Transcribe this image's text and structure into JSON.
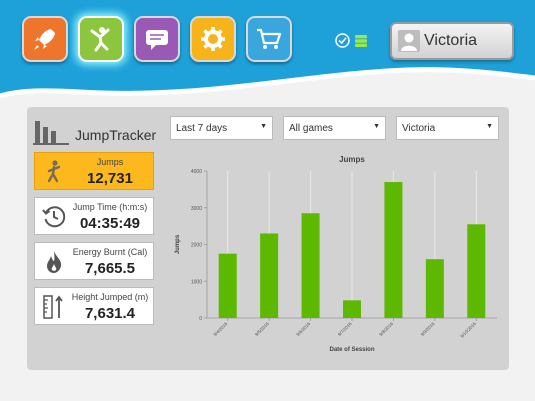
{
  "nav": {
    "apps": [
      {
        "name": "rocket-app-button",
        "color": "#f0752c",
        "icon": "rocket-icon"
      },
      {
        "name": "activity-app-button",
        "color": "#8cc63f",
        "icon": "jumping-person-icon",
        "active": true
      },
      {
        "name": "messages-app-button",
        "color": "#9b59b6",
        "icon": "chat-icon"
      },
      {
        "name": "settings-app-button",
        "color": "#f7b41a",
        "icon": "gear-icon"
      },
      {
        "name": "store-app-button",
        "color": "#3aa6dd",
        "icon": "cart-icon"
      }
    ],
    "topbar_color": "#1ea1d9"
  },
  "user": {
    "name": "Victoria"
  },
  "logo": {
    "title": "JumpTracker"
  },
  "filters": {
    "period": "Last 7 days",
    "game": "All games",
    "player": "Victoria"
  },
  "stats": [
    {
      "label": "Jumps",
      "value": "12,731",
      "icon": "jumper-icon",
      "highlight": true
    },
    {
      "label": "Jump Time (h:m:s)",
      "value": "04:35:49",
      "icon": "clock-icon"
    },
    {
      "label": "Energy Burnt (Cal)",
      "value": "7,665.5",
      "icon": "flame-icon"
    },
    {
      "label": "Height Jumped (m)",
      "value": "7,631.4",
      "icon": "height-ruler-icon"
    }
  ],
  "chart_data": {
    "type": "bar",
    "title": "Jumps",
    "xlabel": "Date of Session",
    "ylabel": "Jumps",
    "categories": [
      "9/4/2016",
      "9/5/2016",
      "9/6/2016",
      "9/7/2016",
      "9/8/2016",
      "9/9/2016",
      "9/10/2016"
    ],
    "values": [
      1750,
      2300,
      2850,
      480,
      3700,
      1600,
      2550
    ],
    "ylim": [
      0,
      4000
    ],
    "yticks": [
      "0",
      "1000",
      "2000",
      "3000",
      "4000"
    ],
    "bar_color": "#5cb800",
    "grid": true
  }
}
